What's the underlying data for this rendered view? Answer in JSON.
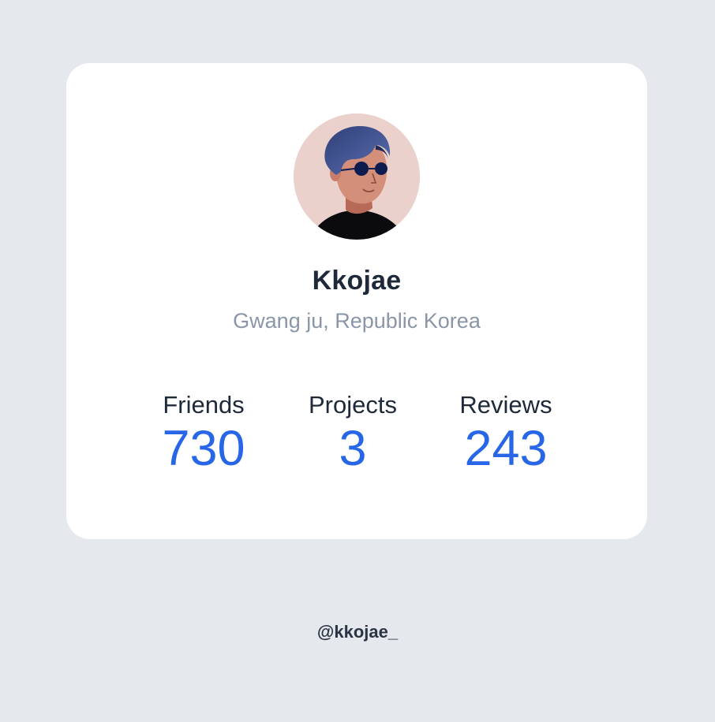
{
  "profile": {
    "name": "Kkojae",
    "location": "Gwang ju, Republic Korea",
    "avatar_icon": "user-avatar-illustration"
  },
  "stats": [
    {
      "label": "Friends",
      "value": "730"
    },
    {
      "label": "Projects",
      "value": "3"
    },
    {
      "label": "Reviews",
      "value": "243"
    }
  ],
  "footer": {
    "handle": "@kkojae_"
  },
  "colors": {
    "background": "#e5e8ed",
    "card": "#ffffff",
    "name_text": "#1e2939",
    "location_text": "#8a96a8",
    "stat_value": "#2866e8",
    "avatar_bg": "#ebd1cb"
  }
}
